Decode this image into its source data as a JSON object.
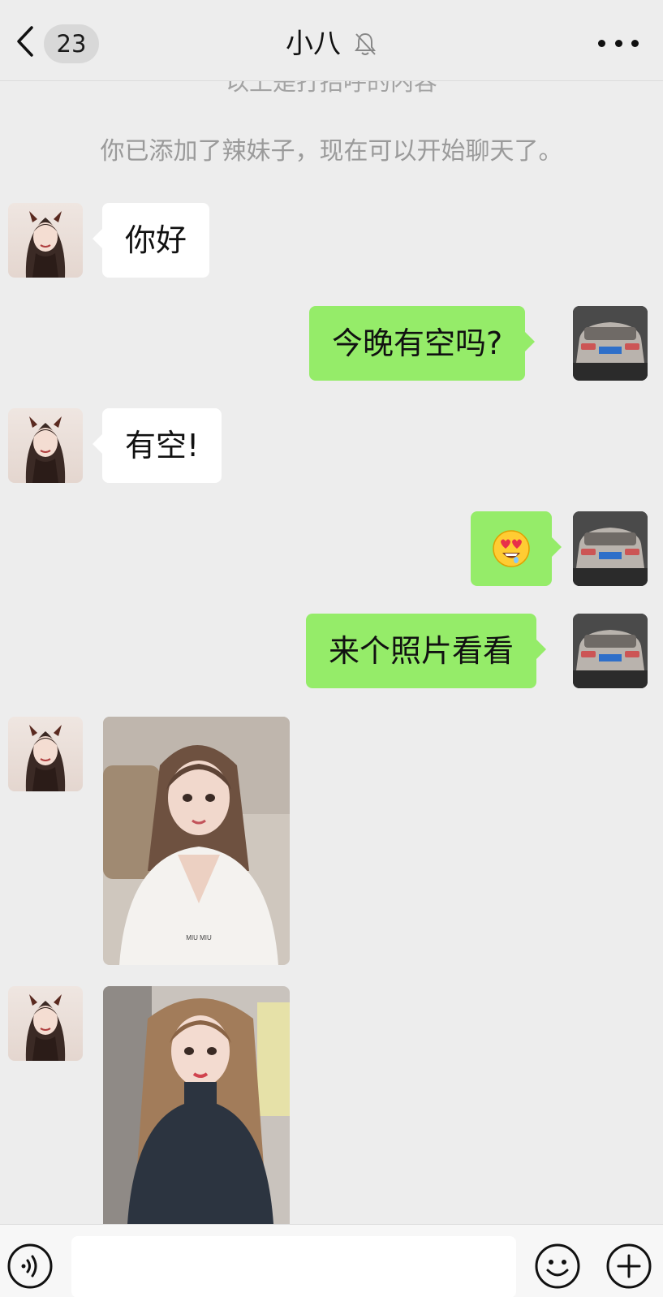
{
  "header": {
    "unread_count": "23",
    "title": "小八",
    "muted_icon": "bell-slash-icon"
  },
  "system": {
    "greeting_notice": "以上是打招呼的内容",
    "added_notice": "你已添加了辣妹子，现在可以开始聊天了。"
  },
  "messages": [
    {
      "side": "left",
      "type": "text",
      "text": "你好"
    },
    {
      "side": "right",
      "type": "text",
      "text": "今晚有空吗?"
    },
    {
      "side": "left",
      "type": "text",
      "text": "有空!"
    },
    {
      "side": "right",
      "type": "emoji",
      "emoji": "😍"
    },
    {
      "side": "right",
      "type": "text",
      "text": "来个照片看看"
    },
    {
      "side": "left",
      "type": "image"
    },
    {
      "side": "left",
      "type": "image"
    }
  ],
  "colors": {
    "background": "#ededed",
    "self_bubble": "#95ec69",
    "other_bubble": "#ffffff",
    "notice_text": "#9a9a9a"
  },
  "input": {
    "placeholder": ""
  }
}
